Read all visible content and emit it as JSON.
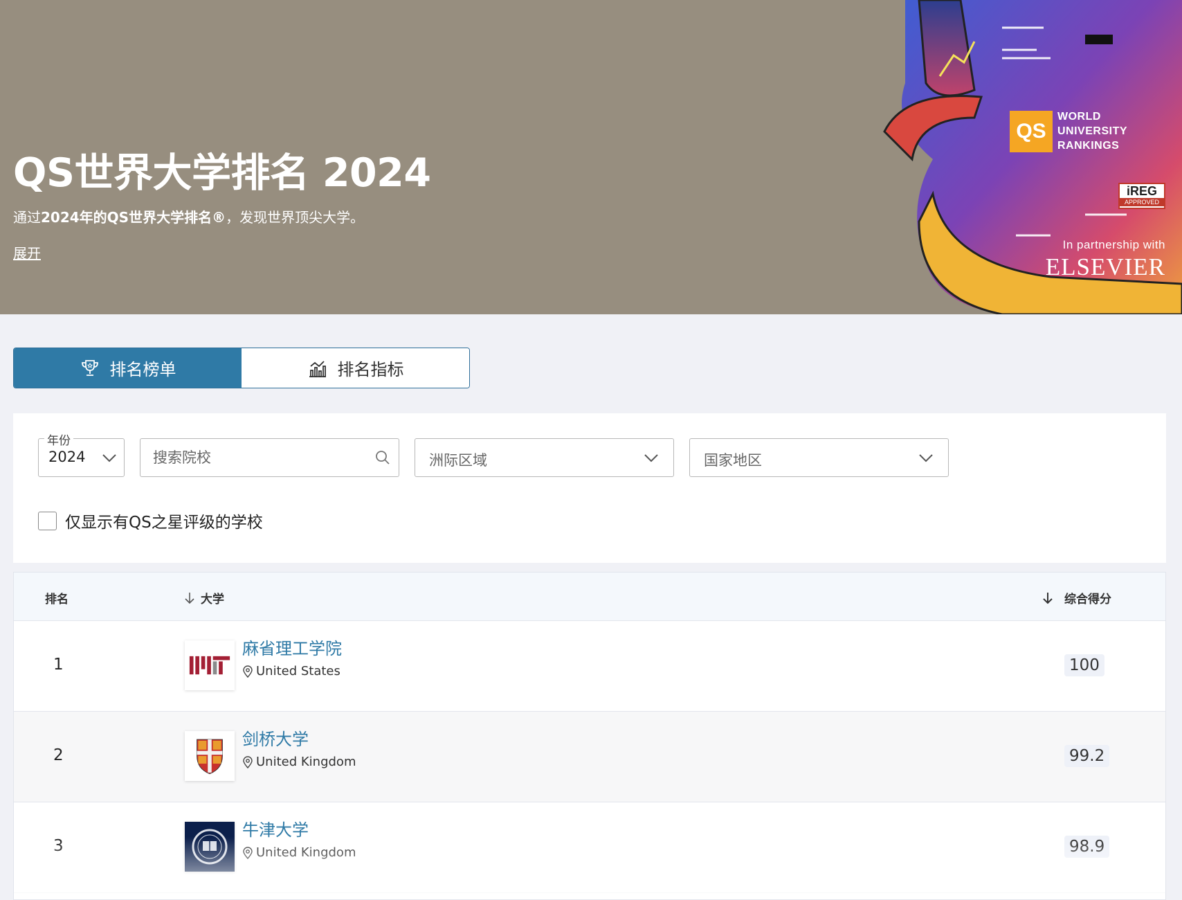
{
  "hero": {
    "title": "QS世界大学排名 2024",
    "subtitle_bold": "2024年的QS世界大学排名®",
    "subtitle_pre": "通过",
    "subtitle_post": "，发现世界顶尖大学。",
    "expand": "展开",
    "qs_badge": "QS",
    "wur_line1": "WORLD",
    "wur_line2": "UNIVERSITY",
    "wur_line3": "RANKINGS",
    "ireg_title": "iREG",
    "ireg_sub": "APPROVED",
    "partner_text": "In partnership with",
    "partner_name": "ELSEVIER",
    "bg_color": "#978e7f",
    "accent_color": "#f5a623"
  },
  "tabs": [
    {
      "label": "排名榜单",
      "icon": "trophy-icon",
      "active": true
    },
    {
      "label": "排名指标",
      "icon": "chart-icon",
      "active": false
    }
  ],
  "filters": {
    "year_legend": "年份",
    "year_value": "2024",
    "search_placeholder": "搜索院校",
    "region_placeholder": "洲际区域",
    "country_placeholder": "国家地区",
    "stars_checkbox_label": "仅显示有QS之星评级的学校"
  },
  "table": {
    "headers": {
      "rank": "排名",
      "university": "大学",
      "score": "综合得分"
    },
    "rows": [
      {
        "rank": "1",
        "name": "麻省理工学院",
        "location": "United States",
        "score": "100",
        "logo": "mit-logo"
      },
      {
        "rank": "2",
        "name": "剑桥大学",
        "location": "United Kingdom",
        "score": "99.2",
        "logo": "cambridge-logo"
      },
      {
        "rank": "3",
        "name": "牛津大学",
        "location": "United Kingdom",
        "score": "98.9",
        "logo": "oxford-logo"
      }
    ]
  },
  "colors": {
    "primary": "#2f7aa6",
    "link": "#2f7aa6",
    "page_bg": "#f0f1f6"
  }
}
